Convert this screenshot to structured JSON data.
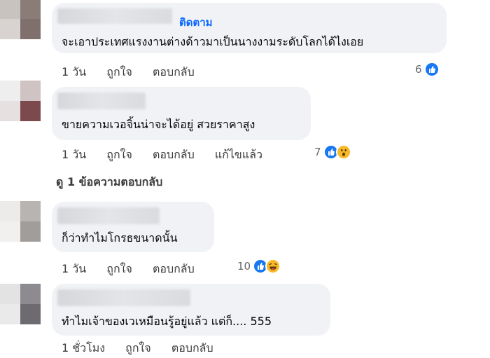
{
  "comments": [
    {
      "follow_label": "ติดตาม",
      "text": "จะเอาประเทศแรงงานต่างด้าวมาเป็นนางงามระดับโลกได้ไงเอย",
      "time": "1 วัน",
      "like_label": "ถูกใจ",
      "reply_label": "ตอบกลับ",
      "reaction_count": "6",
      "reactions": [
        "like-icon"
      ]
    },
    {
      "text": "ขายความเวอจิ้นน่าจะได้อยู่ สวยราคาสูง",
      "time": "1 วัน",
      "like_label": "ถูกใจ",
      "reply_label": "ตอบกลับ",
      "edited_label": "แก้ไขแล้ว",
      "reaction_count": "7",
      "reactions": [
        "like-icon",
        "wow-icon"
      ]
    },
    {
      "text": "ก็ว่าทำไมโกรธขนาดนั้น",
      "time": "1 วัน",
      "like_label": "ถูกใจ",
      "reply_label": "ตอบกลับ",
      "reaction_count": "10",
      "reactions": [
        "like-icon",
        "haha-icon"
      ]
    },
    {
      "text": "ทำไมเจ้าของเวเหมือนรู้อยู่แล้ว แต่ก็.... 555",
      "time": "1 ชั่วโมง",
      "like_label": "ถูกใจ",
      "reply_label": "ตอบกลับ"
    }
  ],
  "view_replies_label": "ดู 1 ข้อความตอบกลับ",
  "colors": {
    "like": "#1877f2",
    "bubble": "#f0f2f5",
    "follow": "#0866ff",
    "emoji": "#f7b928"
  }
}
